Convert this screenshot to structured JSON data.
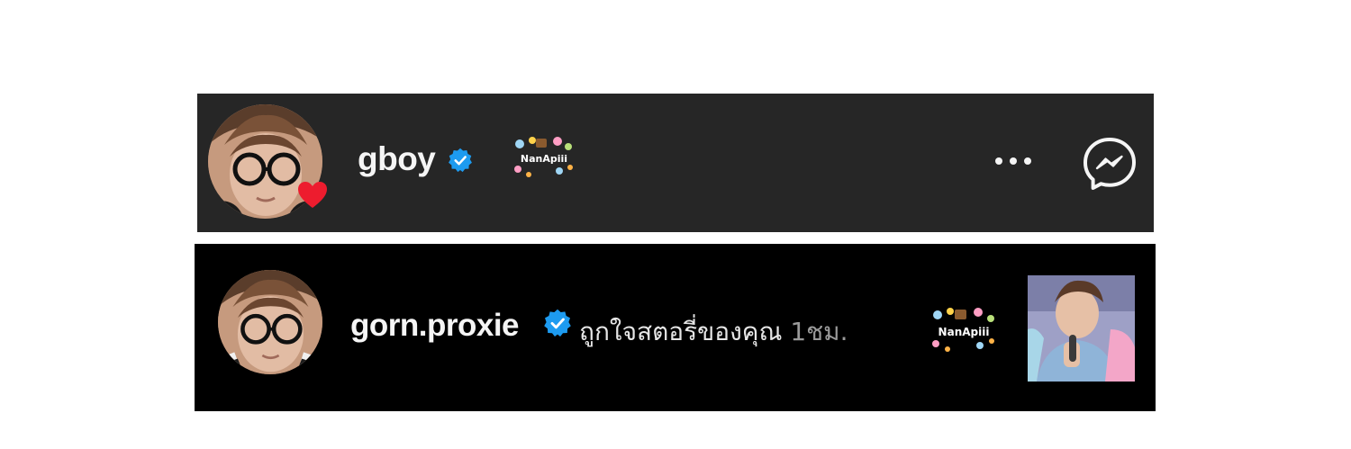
{
  "notification_top": {
    "username": "gboy",
    "verified": true,
    "reaction": "heart-icon",
    "sticker_text": "NanApiii",
    "more_icon": "more-horizontal-icon",
    "action_icon": "messenger-icon"
  },
  "notification_bottom": {
    "username": "gorn.proxie",
    "verified": true,
    "activity_text": "ถูกใจสตอรี่ของคุณ",
    "time": "1ชม.",
    "sticker_text": "NanApiii"
  },
  "colors": {
    "top_strip_bg": "#262626",
    "bottom_strip_bg": "#000000",
    "verified_blue": "#1d9bf0",
    "heart_red": "#ed1c2e",
    "text_primary": "#f5f5f5",
    "text_secondary": "#9a9a9a"
  }
}
